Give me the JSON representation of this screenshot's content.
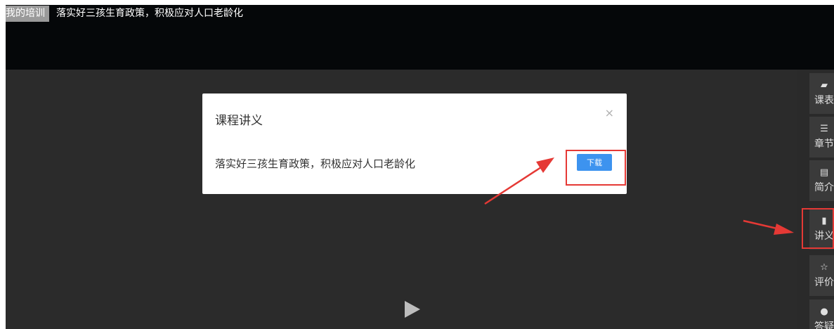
{
  "header": {
    "crumb_badge": "我的培训",
    "course_title": "落实好三孩生育政策，积极应对人口老龄化"
  },
  "sidebar": {
    "items": [
      {
        "icon": "book-icon",
        "glyph": "▰",
        "label": "课表"
      },
      {
        "icon": "list-icon",
        "glyph": "☰",
        "label": "章节"
      },
      {
        "icon": "id-card-icon",
        "glyph": "▤",
        "label": "简介"
      },
      {
        "icon": "document-icon",
        "glyph": "▮",
        "label": "讲义"
      },
      {
        "icon": "star-icon",
        "glyph": "☆",
        "label": "评价"
      },
      {
        "icon": "chat-bubble-icon",
        "glyph": "●",
        "label": "答疑"
      }
    ]
  },
  "modal": {
    "title": "课程讲义",
    "close_glyph": "×",
    "file_name": "落实好三孩生育政策，积极应对人口老龄化",
    "download_label": "下载"
  },
  "player": {
    "play_icon": "play-icon"
  },
  "colors": {
    "accent": "#3d93ef",
    "annotation": "#e53935",
    "header_bg": "#050709",
    "player_bg": "#2b2b2b",
    "sidebar_bg": "#3a3a3a"
  }
}
